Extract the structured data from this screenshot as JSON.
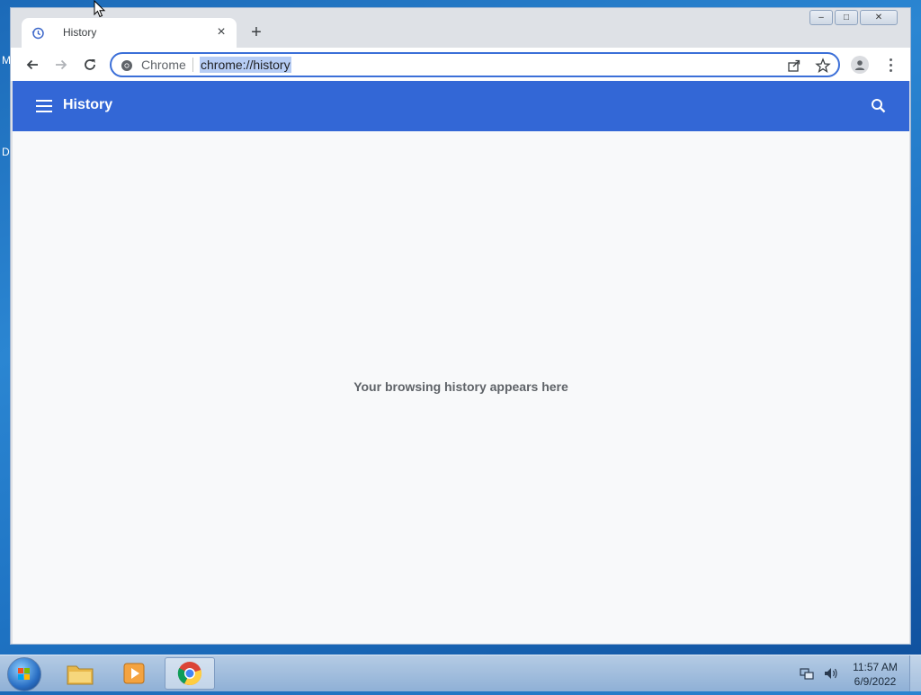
{
  "desktop": {
    "edge_labels": [
      "M",
      "D"
    ]
  },
  "browser": {
    "tab": {
      "title": "History",
      "close_label": "×",
      "icon": "history-icon"
    },
    "new_tab_label": "+",
    "window_controls": {
      "minimize": "–",
      "maximize": "□",
      "close": "✕"
    },
    "omnibox": {
      "site_label": "Chrome",
      "url": "chrome://history"
    },
    "accent_color": "#3367d6"
  },
  "history_page": {
    "title": "History",
    "empty_message": "Your browsing history appears here"
  },
  "taskbar": {
    "pinned": [
      "windows-explorer-icon",
      "media-player-icon",
      "chrome-icon"
    ],
    "active": "chrome-icon",
    "clock": {
      "time": "11:57 AM",
      "date": "6/9/2022"
    }
  }
}
